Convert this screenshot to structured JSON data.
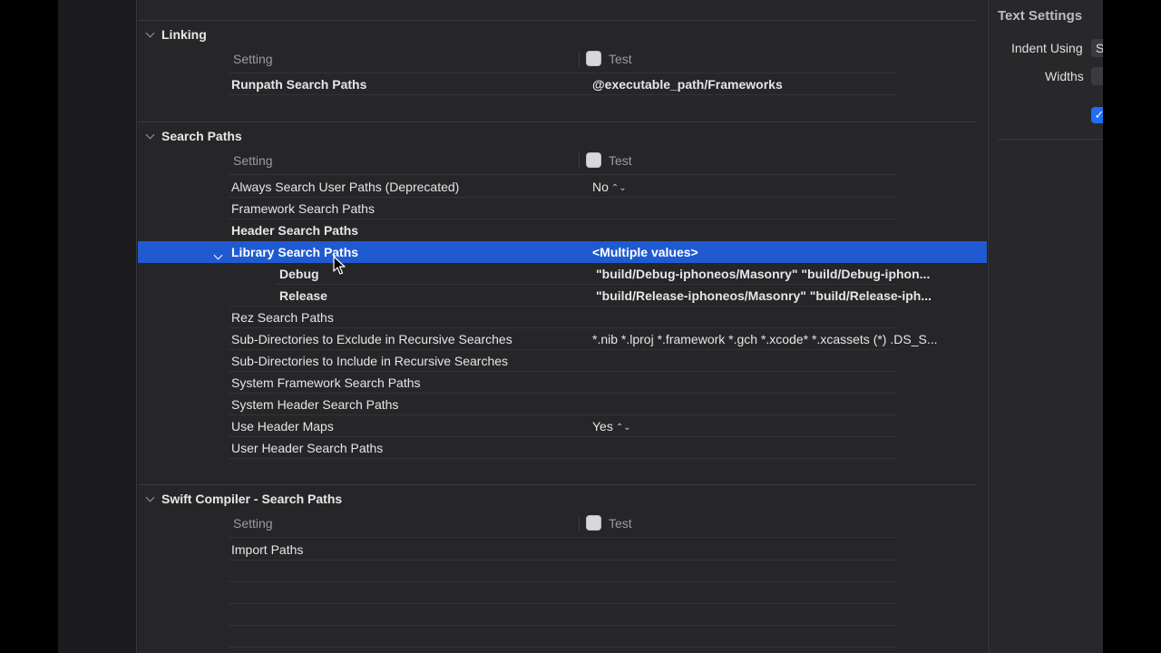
{
  "sections": {
    "linking": {
      "title": "Linking",
      "setting_header": "Setting",
      "target": "Test",
      "rows": [
        {
          "name": "Runpath Search Paths",
          "value": "@executable_path/Frameworks"
        }
      ]
    },
    "search_paths": {
      "title": "Search Paths",
      "setting_header": "Setting",
      "target": "Test",
      "rows": [
        {
          "name": "Always Search User Paths (Deprecated)",
          "value": "No"
        },
        {
          "name": "Framework Search Paths",
          "value": ""
        },
        {
          "name": "Header Search Paths",
          "value": ""
        },
        {
          "name": "Library Search Paths",
          "value": "<Multiple values>"
        },
        {
          "name": "Debug",
          "value": "\"build/Debug-iphoneos/Masonry\" \"build/Debug-iphon..."
        },
        {
          "name": "Release",
          "value": "\"build/Release-iphoneos/Masonry\" \"build/Release-iph..."
        },
        {
          "name": "Rez Search Paths",
          "value": ""
        },
        {
          "name": "Sub-Directories to Exclude in Recursive Searches",
          "value": "*.nib *.lproj *.framework *.gch *.xcode* *.xcassets (*) .DS_S..."
        },
        {
          "name": "Sub-Directories to Include in Recursive Searches",
          "value": ""
        },
        {
          "name": "System Framework Search Paths",
          "value": ""
        },
        {
          "name": "System Header Search Paths",
          "value": ""
        },
        {
          "name": "Use Header Maps",
          "value": "Yes"
        },
        {
          "name": "User Header Search Paths",
          "value": ""
        }
      ]
    },
    "swift": {
      "title": "Swift Compiler - Search Paths",
      "setting_header": "Setting",
      "target": "Test",
      "rows": [
        {
          "name": "Import Paths",
          "value": ""
        }
      ]
    }
  },
  "inspector": {
    "title": "Text Settings",
    "indent_label": "Indent Using",
    "indent_value": "S",
    "widths_label": "Widths",
    "checkbox_mark": "✓"
  },
  "colors": {
    "selection": "#1f5ad1",
    "editor_bg": "#262528",
    "checkbox": "#1f6ff5"
  }
}
